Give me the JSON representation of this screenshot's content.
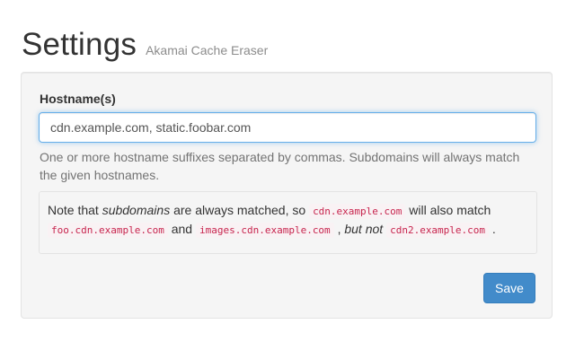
{
  "header": {
    "title": "Settings",
    "subtitle": "Akamai Cache Eraser"
  },
  "form": {
    "hostname_label": "Hostname(s)",
    "hostname_value": "cdn.example.com, static.foobar.com",
    "help_text": "One or more hostname suffixes separated by commas. Subdomains will always match the given hostnames.",
    "note": {
      "prefix": "Note that ",
      "emphasis": "subdomains",
      "middle": " are always matched, so ",
      "example_host": "cdn.example.com",
      "will_match": " will also match",
      "match_one": "foo.cdn.example.com",
      "and": " and ",
      "match_two": "images.cdn.example.com",
      "comma": " , ",
      "but_not": "but not",
      "non_match": "cdn2.example.com",
      "period": " ."
    },
    "save_label": "Save"
  },
  "colors": {
    "accent": "#428bca",
    "panel_bg": "#f5f5f5",
    "code_text": "#c7254e",
    "input_focus_border": "#66afe9"
  }
}
